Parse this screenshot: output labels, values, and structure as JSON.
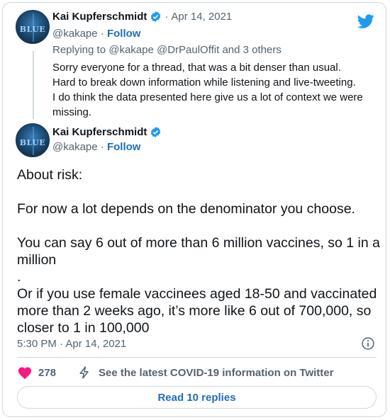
{
  "colors": {
    "twitter_blue": "#1d9bf0",
    "link": "#1d6fb8",
    "secondary": "#536471",
    "heart": "#f91880",
    "border": "#cfd9de"
  },
  "tweet1": {
    "author_name": "Kai Kupferschmidt",
    "handle": "@kakape",
    "separator": "·",
    "follow_label": "Follow",
    "date": "Apr 14, 2021",
    "replying_to": "Replying to @kakape @DrPaulOffit and 3 others",
    "text": "Sorry everyone for a thread, that was a bit denser than usual.\nHard to break down information while listening and live-tweeting.\nI do think the data presented here give us a lot of context we were missing.",
    "avatar_text": "BLUE"
  },
  "tweet2": {
    "author_name": "Kai Kupferschmidt",
    "handle": "@kakape",
    "separator": "·",
    "follow_label": "Follow",
    "avatar_text": "BLUE",
    "text": "About risk:\n\nFor now a lot depends on the denominator you choose.\n\nYou can say 6 out of more than 6 million vaccines, so 1 in a million\n.\nOr if you use female vaccinees aged 18-50 and vaccinated more than 2 weeks ago, it’s more like 6 out of 700,000, so closer to 1 in 100,000",
    "timestamp": "5:30 PM · Apr 14, 2021",
    "likes": "278",
    "covid_info": "See the latest COVID-19 information on Twitter",
    "read_replies": "Read 10 replies"
  },
  "icons": [
    "twitter-bird-icon",
    "verified-badge-icon",
    "heart-icon",
    "lightning-icon",
    "info-icon"
  ]
}
